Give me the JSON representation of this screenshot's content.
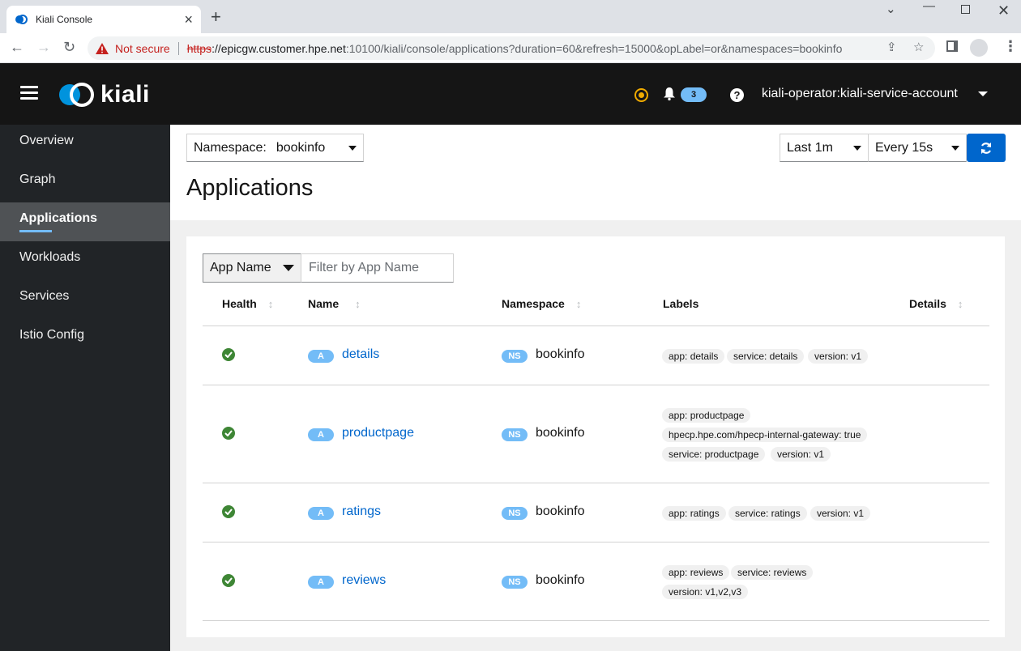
{
  "browser": {
    "tab_title": "Kiali Console",
    "not_secure": "Not secure",
    "url_scheme": "https",
    "url_host": "://epicgw.customer.hpe.net",
    "url_rest": ":10100/kiali/console/applications?duration=60&refresh=15000&opLabel=or&namespaces=bookinfo"
  },
  "masthead": {
    "logo_text": "kiali",
    "notification_count": "3",
    "help_glyph": "?",
    "user": "kiali-operator:kiali-service-account"
  },
  "sidebar": {
    "items": [
      {
        "label": "Overview"
      },
      {
        "label": "Graph"
      },
      {
        "label": "Applications"
      },
      {
        "label": "Workloads"
      },
      {
        "label": "Services"
      },
      {
        "label": "Istio Config"
      }
    ],
    "active_index": 2
  },
  "toolbar": {
    "namespace_label": "Namespace:",
    "namespace_value": "bookinfo",
    "duration": "Last 1m",
    "refresh_interval": "Every 15s"
  },
  "page_title": "Applications",
  "filter": {
    "type": "App Name",
    "placeholder": "Filter by App Name"
  },
  "table": {
    "columns": [
      "Health",
      "Name",
      "Namespace",
      "Labels",
      "Details"
    ],
    "app_badge": "A",
    "ns_badge": "NS",
    "rows": [
      {
        "health": "healthy",
        "name": "details",
        "namespace": "bookinfo",
        "labels": [
          "app: details",
          "service: details",
          "version: v1"
        ]
      },
      {
        "health": "healthy",
        "name": "productpage",
        "namespace": "bookinfo",
        "labels": [
          "app: productpage",
          "hpecp.hpe.com/hpecp-internal-gateway: true",
          "service: productpage",
          "version: v1"
        ]
      },
      {
        "health": "healthy",
        "name": "ratings",
        "namespace": "bookinfo",
        "labels": [
          "app: ratings",
          "service: ratings",
          "version: v1"
        ]
      },
      {
        "health": "healthy",
        "name": "reviews",
        "namespace": "bookinfo",
        "labels": [
          "app: reviews",
          "service: reviews",
          "version: v1,v2,v3"
        ]
      }
    ]
  },
  "colors": {
    "masthead_bg": "#151515",
    "sidebar_bg": "#212427",
    "accent_blue": "#0066cc",
    "badge_blue": "#73bcf7",
    "healthy_green": "#3e8635",
    "warning_orange": "#f0ab00"
  }
}
